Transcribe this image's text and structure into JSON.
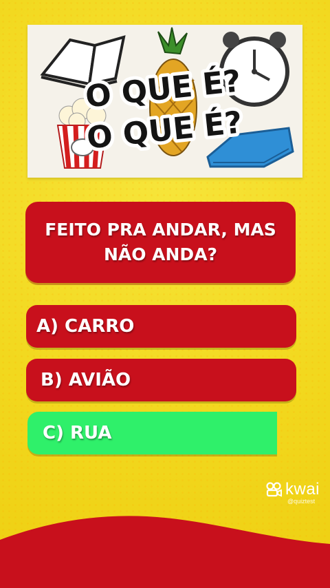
{
  "banner": {
    "title_line1": "O QUE É?",
    "title_line2": "O QUE É?"
  },
  "question": {
    "text": "FEITO PRA ANDAR, MAS NÃO ANDA?"
  },
  "options": [
    {
      "label": "A) CARRO",
      "state": "default"
    },
    {
      "label": "B) AVIÃO",
      "state": "default"
    },
    {
      "label": "C) RUA",
      "state": "correct"
    }
  ],
  "watermark": {
    "brand": "kwai",
    "handle": "@quiztest"
  },
  "colors": {
    "background": "#f2d81e",
    "question_box": "#c8101c",
    "option_default": "#c8101c",
    "option_correct": "#2ff06a",
    "wave": "#c8101c",
    "text": "#ffffff"
  }
}
